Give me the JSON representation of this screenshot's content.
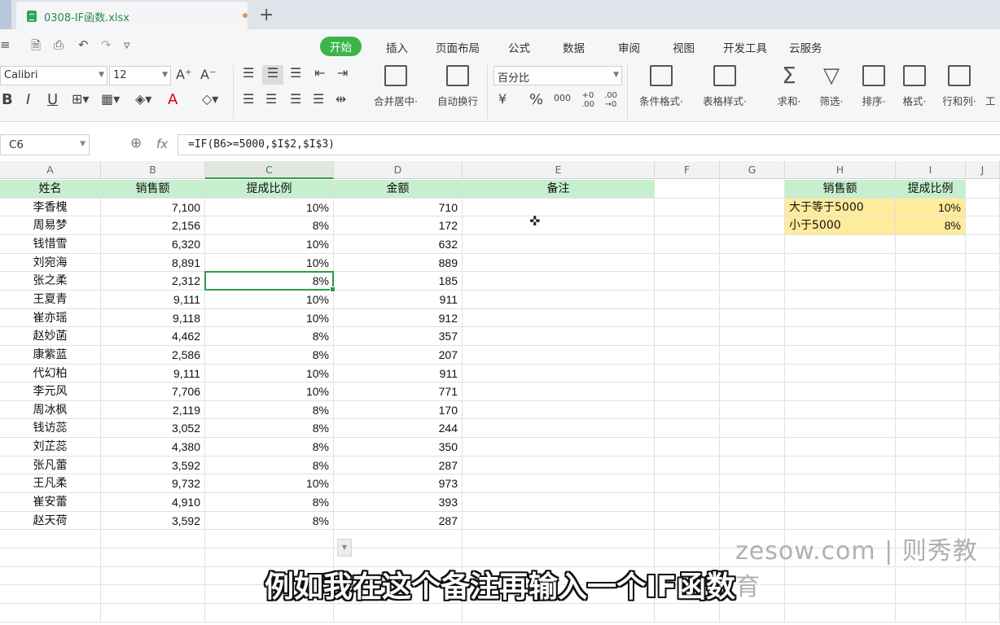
{
  "tab": {
    "filename": "0308-IF函数.xlsx",
    "new_tab": "+"
  },
  "quick_access": {
    "menu_glyph": "≡",
    "save": "🗎",
    "print": "⎙",
    "undo": "↶",
    "redo": "↷",
    "more": "▿"
  },
  "menu": [
    "开始",
    "插入",
    "页面布局",
    "公式",
    "数据",
    "审阅",
    "视图",
    "开发工具",
    "云服务"
  ],
  "font": {
    "name": "Calibri",
    "size": "12"
  },
  "number_format": "百分比",
  "ribbon_buttons": {
    "merge": "合并居中·",
    "wrap": "自动换行",
    "cond_format": "条件格式·",
    "table_style": "表格样式·",
    "sum": "求和·",
    "filter": "筛选·",
    "sort": "排序·",
    "format": "格式·",
    "rowcol": "行和列·",
    "cut": "工"
  },
  "format_buttons": {
    "bold": "B",
    "italic": "I",
    "underline": "U",
    "font_color": "A",
    "percent": "%",
    "comma": "000",
    "inc_decimal": "+0 .00",
    "dec_decimal": ".00 →0",
    "currency": "¥",
    "grow": "A⁺",
    "shrink": "A⁻"
  },
  "name_box": "C6",
  "formula": "=IF(B6>=5000,$I$2,$I$3)",
  "columns": [
    "A",
    "B",
    "C",
    "D",
    "E",
    "F",
    "G",
    "H",
    "I",
    "J"
  ],
  "headers": {
    "name": "姓名",
    "sales": "销售额",
    "rate": "提成比例",
    "amount": "金额",
    "note": "备注"
  },
  "rows": [
    {
      "name": "李香槐",
      "sales": "7,100",
      "rate": "10%",
      "amount": "710"
    },
    {
      "name": "周易梦",
      "sales": "2,156",
      "rate": "8%",
      "amount": "172"
    },
    {
      "name": "钱惜雪",
      "sales": "6,320",
      "rate": "10%",
      "amount": "632"
    },
    {
      "name": "刘宛海",
      "sales": "8,891",
      "rate": "10%",
      "amount": "889"
    },
    {
      "name": "张之柔",
      "sales": "2,312",
      "rate": "8%",
      "amount": "185"
    },
    {
      "name": "王夏青",
      "sales": "9,111",
      "rate": "10%",
      "amount": "911"
    },
    {
      "name": "崔亦瑶",
      "sales": "9,118",
      "rate": "10%",
      "amount": "912"
    },
    {
      "name": "赵妙菡",
      "sales": "4,462",
      "rate": "8%",
      "amount": "357"
    },
    {
      "name": "康紫蓝",
      "sales": "2,586",
      "rate": "8%",
      "amount": "207"
    },
    {
      "name": "代幻柏",
      "sales": "9,111",
      "rate": "10%",
      "amount": "911"
    },
    {
      "name": "李元风",
      "sales": "7,706",
      "rate": "10%",
      "amount": "771"
    },
    {
      "name": "周冰枫",
      "sales": "2,119",
      "rate": "8%",
      "amount": "170"
    },
    {
      "name": "钱访蕊",
      "sales": "3,052",
      "rate": "8%",
      "amount": "244"
    },
    {
      "name": "刘芷蕊",
      "sales": "4,380",
      "rate": "8%",
      "amount": "350"
    },
    {
      "name": "张凡蕾",
      "sales": "3,592",
      "rate": "8%",
      "amount": "287"
    },
    {
      "name": "王凡柔",
      "sales": "9,732",
      "rate": "10%",
      "amount": "973"
    },
    {
      "name": "崔安蕾",
      "sales": "4,910",
      "rate": "8%",
      "amount": "393"
    },
    {
      "name": "赵天荷",
      "sales": "3,592",
      "rate": "8%",
      "amount": "287"
    }
  ],
  "lookup": {
    "header_sales": "销售额",
    "header_rate": "提成比例",
    "rows": [
      {
        "label": "大于等于5000",
        "rate": "10%"
      },
      {
        "label": "小于5000",
        "rate": "8%"
      }
    ]
  },
  "watermark": "zesow.com | 则秀教育",
  "subtitle": "例如我在这个备注再输入一个IF函数",
  "colors": {
    "accent": "#3bb54a",
    "header_fill": "#c6efce",
    "lookup_fill": "#ffeb9c"
  }
}
